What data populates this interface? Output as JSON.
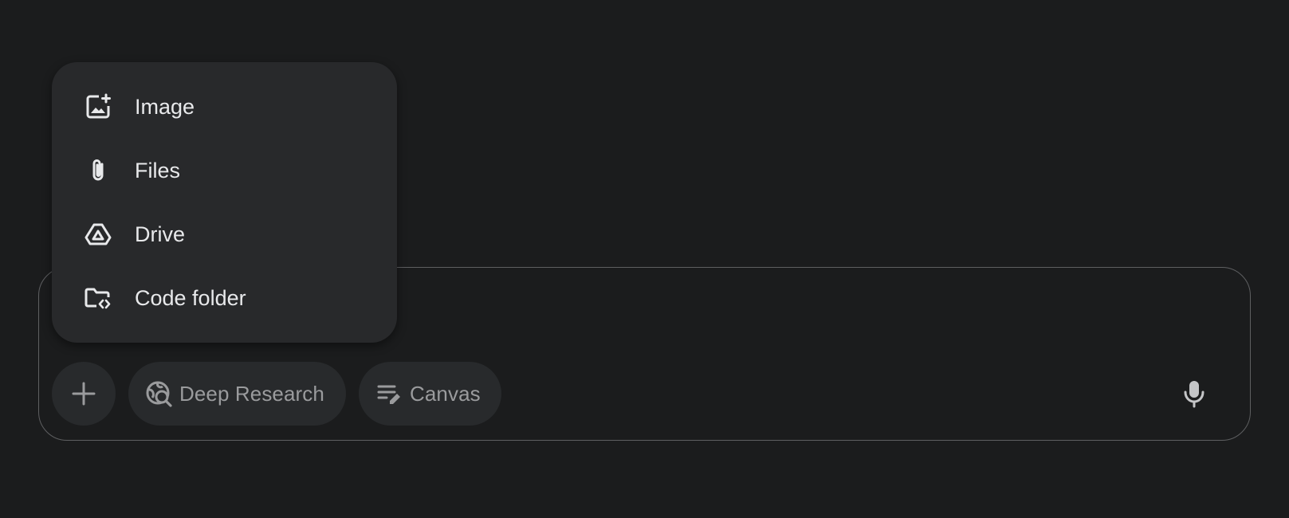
{
  "colors": {
    "background": "#1b1c1d",
    "surface": "#282a2c",
    "menu_surface": "#28292b",
    "border": "#5e5f61",
    "menu_text": "#e8e9eb",
    "chip_text": "#9a9b9d"
  },
  "upload_menu": {
    "items": [
      {
        "label": "Image",
        "icon": "add-image-icon"
      },
      {
        "label": "Files",
        "icon": "paperclip-icon"
      },
      {
        "label": "Drive",
        "icon": "drive-icon"
      },
      {
        "label": "Code folder",
        "icon": "code-folder-icon"
      }
    ]
  },
  "composer": {
    "add_icon": "plus-icon",
    "chips": [
      {
        "label": "Deep Research",
        "icon": "deep-research-icon"
      },
      {
        "label": "Canvas",
        "icon": "canvas-icon"
      }
    ],
    "mic_icon": "microphone-icon"
  }
}
